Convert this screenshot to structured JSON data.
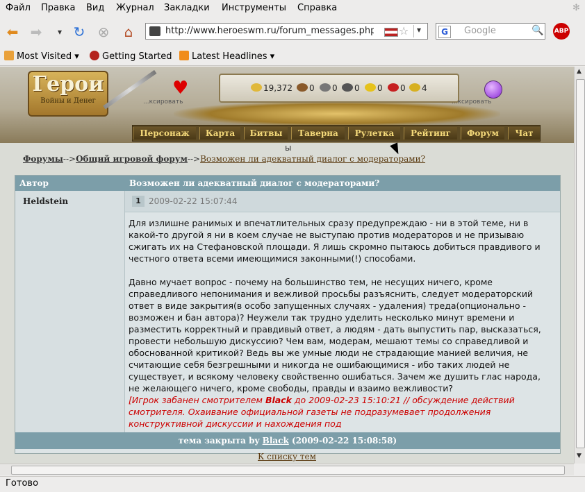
{
  "menu": [
    "Файл",
    "Правка",
    "Вид",
    "Журнал",
    "Закладки",
    "Инструменты",
    "Справка"
  ],
  "toolbar": {
    "url": "http://www.heroeswm.ru/forum_messages.php?t",
    "search_placeholder": "Google",
    "adblock_label": "ABP"
  },
  "bookmarks": [
    "Most Visited",
    "Getting Started",
    "Latest Headlines"
  ],
  "game": {
    "logo_title": "Герои",
    "logo_subtitle": "Войны и Денег",
    "heart_label": "...ксировать",
    "potion_label": "...ксировать",
    "resources": [
      "19,372",
      "0",
      "0",
      "0",
      "0",
      "0",
      "4"
    ],
    "nav": [
      "Персонаж",
      "Карта",
      "Битвы",
      "Таверна",
      "Рулетка",
      "Рейтинг",
      "Форум",
      "Чат"
    ]
  },
  "stray_text": "ы",
  "breadcrumb": {
    "forums": "Форумы",
    "sep1": "-->",
    "section": "Общий игровой форум",
    "sep2": "-->",
    "topic": "Возможен ли адекватный диалог с модераторами?"
  },
  "thread": {
    "col_author": "Автор",
    "col_title": "Возможен ли адекватный диалог с модераторами?",
    "author": "Heldstein",
    "post_number": "1",
    "post_date": "2009-02-22 15:07:44",
    "para1_lines": [
      "Для излишне ранимых и впечатлительных сразу предупреждаю - ни в этой теме, ни в",
      "какой-то другой я ни в коем случае не выступаю против модераторов и не призываю",
      "сжигать их на Стефановской площади. Я лишь скромно пытаюсь добиться правдивого и",
      "честного ответа всеми имеющимися законными(!) способами."
    ],
    "para2_lines": [
      "Давно мучает вопрос - почему на большинство тем, не несущих ничего, кроме",
      "справедливого непонимания и вежливой просьбы разъяснить, следует модераторский",
      "ответ в виде закрытия(в особо запущенных случаях - удаления) треда(опционально -",
      "возможен и бан автора)? Неужели так трудно уделить несколько минут времени и",
      "разместить корректный и правдивый ответ, а людям - дать выпустить пар, высказаться,",
      "провести небольшую дискуссию? Чем вам, модерам, мешают темы со справедливой и",
      "обоснованной критикой? Ведь вы же умные люди не страдающие манией величия, не",
      "считающие себя безгрешными и никогда не ошибающимися - ибо таких людей не",
      "существует, и всякому человеку свойственно ошибаться. Зачем же душить глас народа,",
      "не желающего ничего, кроме свободы, правды и взаимо вежливости?"
    ],
    "ban_prefix": "[Игрок забанен смотрителем ",
    "ban_moderator": "Black",
    "ban_line1_rest": " до 2009-02-23 15:10:21 // обсуждение действий",
    "ban_line2": "смотрителя. Охаивание официальной газеты не подразумевает продолжения",
    "ban_line3": "конструктивной дискуссии и нахождения под",
    "closed_prefix": "тема закрыта by ",
    "closed_by": "Black",
    "closed_date": " (2009-02-22 15:08:58)",
    "back_link": "К списку тем"
  },
  "status": "Готово"
}
